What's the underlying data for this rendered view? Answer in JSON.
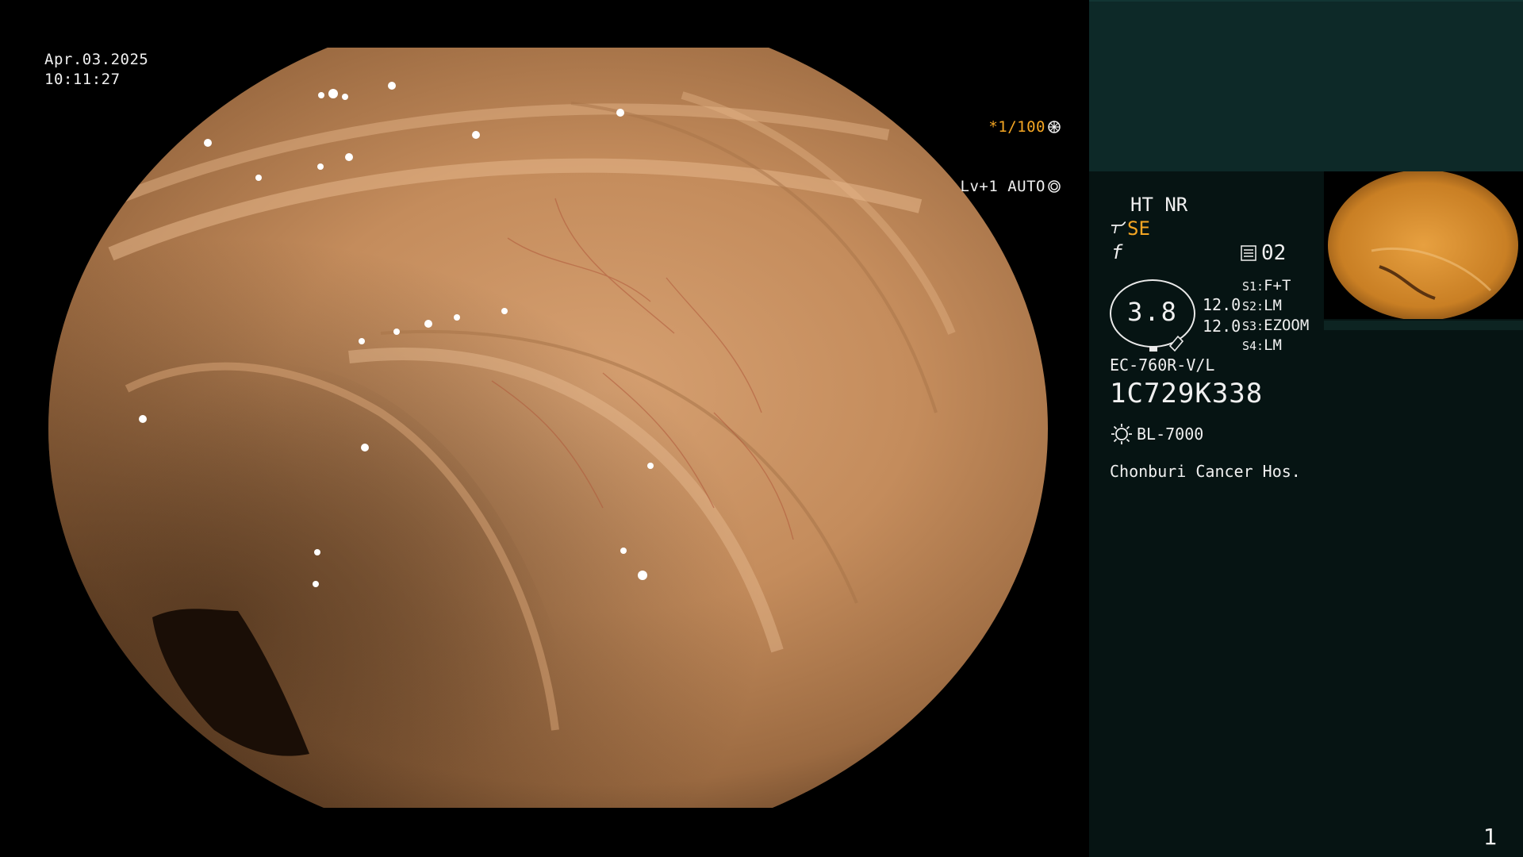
{
  "overlay": {
    "date": "Apr.03.2025",
    "time": "10:11:27",
    "shutter": "*1/100",
    "level": "Lv+1 AUTO"
  },
  "panel": {
    "mode": "HT NR",
    "enhance": "SE",
    "f_symbol": "f",
    "memo_count": "02",
    "zoom": "3.8",
    "value_1": "12.0",
    "value_2": "12.0",
    "switches": [
      {
        "key": "S1:",
        "value": "F+T"
      },
      {
        "key": "S2:",
        "value": "LM"
      },
      {
        "key": "S3:",
        "value": "EZOOM"
      },
      {
        "key": "S4:",
        "value": "LM"
      }
    ],
    "scope_model": "EC-760R-V/L",
    "serial": "1C729K338",
    "light_source": "BL-7000",
    "hospital": "Chonburi Cancer Hos.",
    "page": "1"
  },
  "colors": {
    "accent": "#f5a623",
    "panel_top": "#0d2928",
    "panel_bg": "#061413"
  }
}
